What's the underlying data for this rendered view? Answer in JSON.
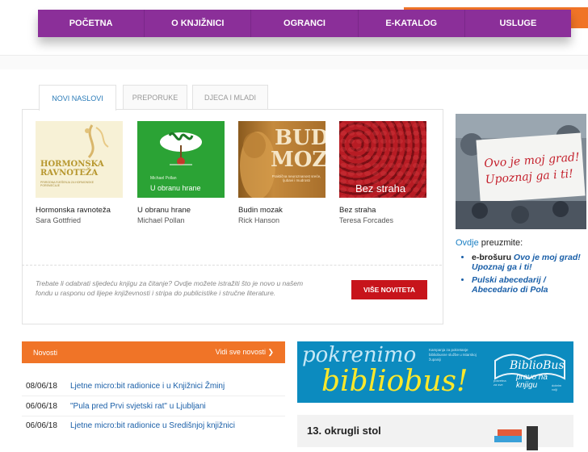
{
  "nav": [
    "POČETNA",
    "O KNJIŽNICI",
    "OGRANCI",
    "E-KATALOG",
    "USLUGE"
  ],
  "tabs": [
    "NOVI NASLOVI",
    "PREPORUKE",
    "DJECA I MLADI"
  ],
  "books": [
    {
      "title": "Hormonska ravnoteža",
      "author": "Sara Gottfried",
      "cover_text": [
        "HORMONSKA",
        "RAVNOTEŽA"
      ],
      "cover_sub": "PRIRODNA RJEŠENJA ZA HORMONSKE POREMEĆAJE"
    },
    {
      "title": "U obranu hrane",
      "author": "Michael Pollan",
      "cover_text": [
        "Michael Pollan",
        "U obranu hrane"
      ]
    },
    {
      "title": "Budin mozak",
      "author": "Rick Hanson",
      "cover_text": [
        "BUDIN",
        "MOZAK"
      ],
      "cover_sub": "Praktična neuroznanost sreće, ljubavi i mudrosti"
    },
    {
      "title": "Bez straha",
      "author": "Teresa Forcades",
      "cover_text": [
        "Bez straha"
      ]
    }
  ],
  "panel_text": "Trebate li odabrati sljedeću knjigu za čitanje? Ovdje možete istražiti što je novo u našem fondu u rasponu od lijepe književnosti i stripa do publicistike i stručne literature.",
  "more_button": "VIŠE NOVITETA",
  "promo_text": [
    "Ovo je moj grad!",
    "Upoznaj ga i ti!"
  ],
  "download": {
    "link": "Ovdje",
    "rest": " preuzmite:",
    "items": [
      {
        "plain": "e-brošuru ",
        "italic": "Ovo je moj grad! Upoznaj ga i ti!"
      },
      {
        "plain": "",
        "italic": "Pulski abecedarij / Abecedario di Pola"
      }
    ]
  },
  "news": {
    "title": "Novosti",
    "all": "Vidi sve novosti ❯",
    "items": [
      {
        "date": "08/06/18",
        "title": "Ljetne micro:bit radionice i u Knjižnici Žminj"
      },
      {
        "date": "06/06/18",
        "title": "\"Pula pred Prvi svjetski rat\" u Ljubljani"
      },
      {
        "date": "06/06/18",
        "title": "Ljetne micro:bit radionice u Središnjoj knjižnici"
      }
    ]
  },
  "bibliobus": {
    "line1": "pokrenimo",
    "line2": "bibliobus!",
    "small": "Kampanja za pokretanje bibliobusne službe u Istarskoj županiji",
    "logo": "BiblioBus",
    "logo_sub": [
      "pravo na",
      "knjigu"
    ],
    "logo_small": [
      "pokretna",
      "za sve",
      "dobrim",
      "volji"
    ]
  },
  "okrugli": "13. okrugli stol"
}
